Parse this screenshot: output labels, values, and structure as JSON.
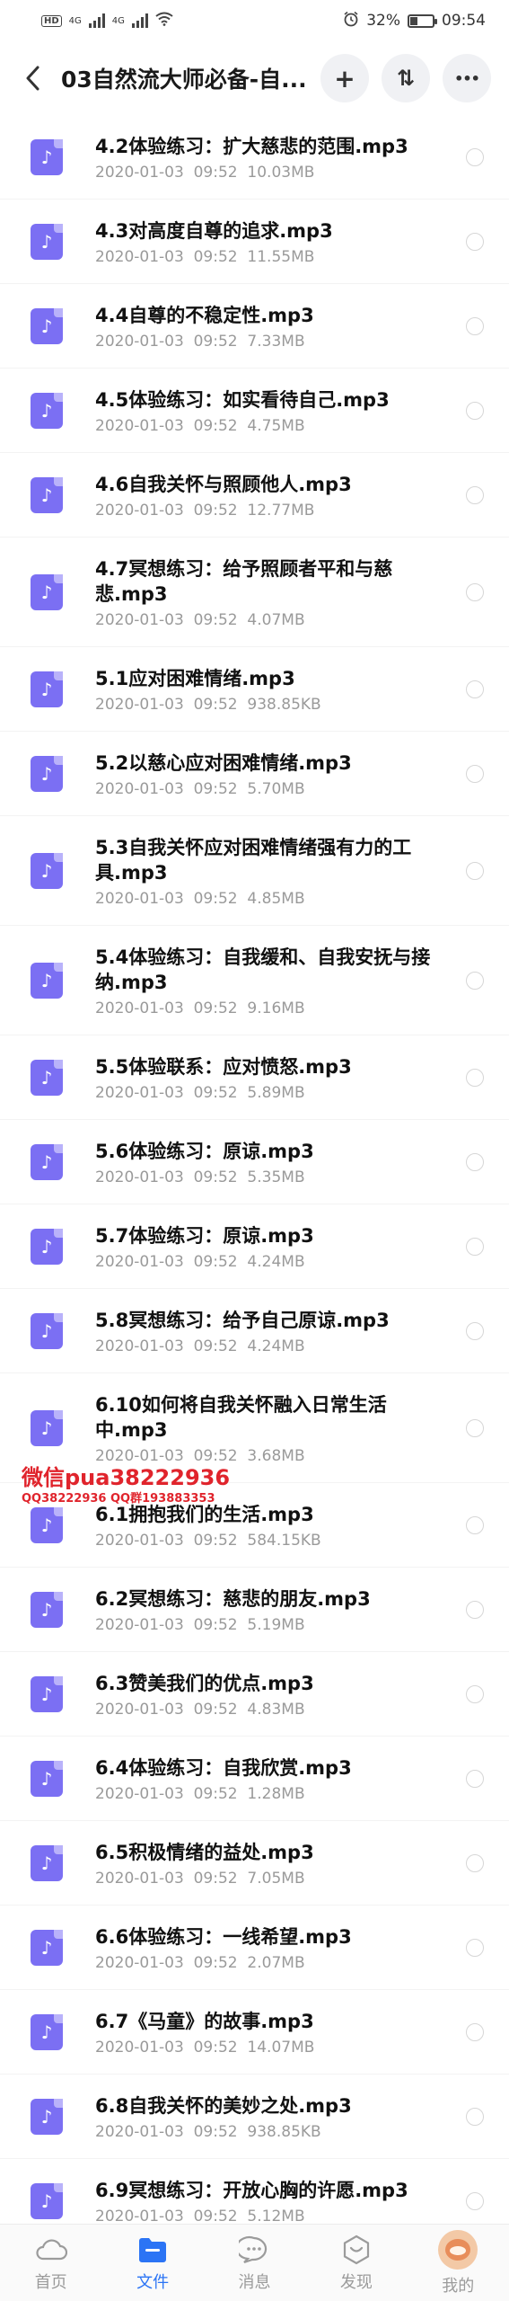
{
  "status_bar": {
    "hd_badge": "HD",
    "network_1": "4G",
    "network_2": "4G",
    "battery": "32%",
    "time": "09:54"
  },
  "header": {
    "title": "03自然流大师必备-自...",
    "add_icon": "+",
    "sort_icon": "⇅",
    "more_icon": "•••"
  },
  "files": [
    {
      "name": "4.2体验练习：扩大慈悲的范围.mp3",
      "date": "2020-01-03  09:52",
      "size": "10.03MB"
    },
    {
      "name": "4.3对高度自尊的追求.mp3",
      "date": "2020-01-03  09:52",
      "size": "11.55MB"
    },
    {
      "name": "4.4自尊的不稳定性.mp3",
      "date": "2020-01-03  09:52",
      "size": "7.33MB"
    },
    {
      "name": "4.5体验练习：如实看待自己.mp3",
      "date": "2020-01-03  09:52",
      "size": "4.75MB"
    },
    {
      "name": "4.6自我关怀与照顾他人.mp3",
      "date": "2020-01-03  09:52",
      "size": "12.77MB"
    },
    {
      "name": "4.7冥想练习：给予照顾者平和与慈悲.mp3",
      "date": "2020-01-03  09:52",
      "size": "4.07MB"
    },
    {
      "name": "5.1应对困难情绪.mp3",
      "date": "2020-01-03  09:52",
      "size": "938.85KB"
    },
    {
      "name": "5.2以慈心应对困难情绪.mp3",
      "date": "2020-01-03  09:52",
      "size": "5.70MB"
    },
    {
      "name": "5.3自我关怀应对困难情绪强有力的工具.mp3",
      "date": "2020-01-03  09:52",
      "size": "4.85MB"
    },
    {
      "name": "5.4体验练习：自我缓和、自我安抚与接纳.mp3",
      "date": "2020-01-03  09:52",
      "size": "9.16MB"
    },
    {
      "name": "5.5体验联系：应对愤怒.mp3",
      "date": "2020-01-03  09:52",
      "size": "5.89MB"
    },
    {
      "name": "5.6体验练习：原谅.mp3",
      "date": "2020-01-03  09:52",
      "size": "5.35MB"
    },
    {
      "name": "5.7体验练习：原谅.mp3",
      "date": "2020-01-03  09:52",
      "size": "4.24MB"
    },
    {
      "name": "5.8冥想练习：给予自己原谅.mp3",
      "date": "2020-01-03  09:52",
      "size": "4.24MB"
    },
    {
      "name": "6.10如何将自我关怀融入日常生活中.mp3",
      "date": "2020-01-03  09:52",
      "size": "3.68MB"
    },
    {
      "name": "6.1拥抱我们的生活.mp3",
      "date": "2020-01-03  09:52",
      "size": "584.15KB"
    },
    {
      "name": "6.2冥想练习：慈悲的朋友.mp3",
      "date": "2020-01-03  09:52",
      "size": "5.19MB"
    },
    {
      "name": "6.3赞美我们的优点.mp3",
      "date": "2020-01-03  09:52",
      "size": "4.83MB"
    },
    {
      "name": "6.4体验练习：自我欣赏.mp3",
      "date": "2020-01-03  09:52",
      "size": "1.28MB"
    },
    {
      "name": "6.5积极情绪的益处.mp3",
      "date": "2020-01-03  09:52",
      "size": "7.05MB"
    },
    {
      "name": "6.6体验练习：一线希望.mp3",
      "date": "2020-01-03  09:52",
      "size": "2.07MB"
    },
    {
      "name": "6.7《马童》的故事.mp3",
      "date": "2020-01-03  09:52",
      "size": "14.07MB"
    },
    {
      "name": "6.8自我关怀的美妙之处.mp3",
      "date": "2020-01-03  09:52",
      "size": "938.85KB"
    },
    {
      "name": "6.9冥想练习：开放心胸的许愿.mp3",
      "date": "2020-01-03  09:52",
      "size": "5.12MB"
    }
  ],
  "watermark": {
    "line1": "微信pua38222936",
    "line2": "QQ38222936  QQ群193883353"
  },
  "bottom_nav": [
    {
      "label": "首页",
      "icon": "cloud-icon"
    },
    {
      "label": "文件",
      "icon": "folder-icon"
    },
    {
      "label": "消息",
      "icon": "message-icon"
    },
    {
      "label": "发现",
      "icon": "discover-icon"
    },
    {
      "label": "我的",
      "icon": "avatar-icon"
    }
  ],
  "colors": {
    "accent": "#2b74f5",
    "file_icon": "#7b6ff3",
    "watermark": "#e0242c"
  }
}
